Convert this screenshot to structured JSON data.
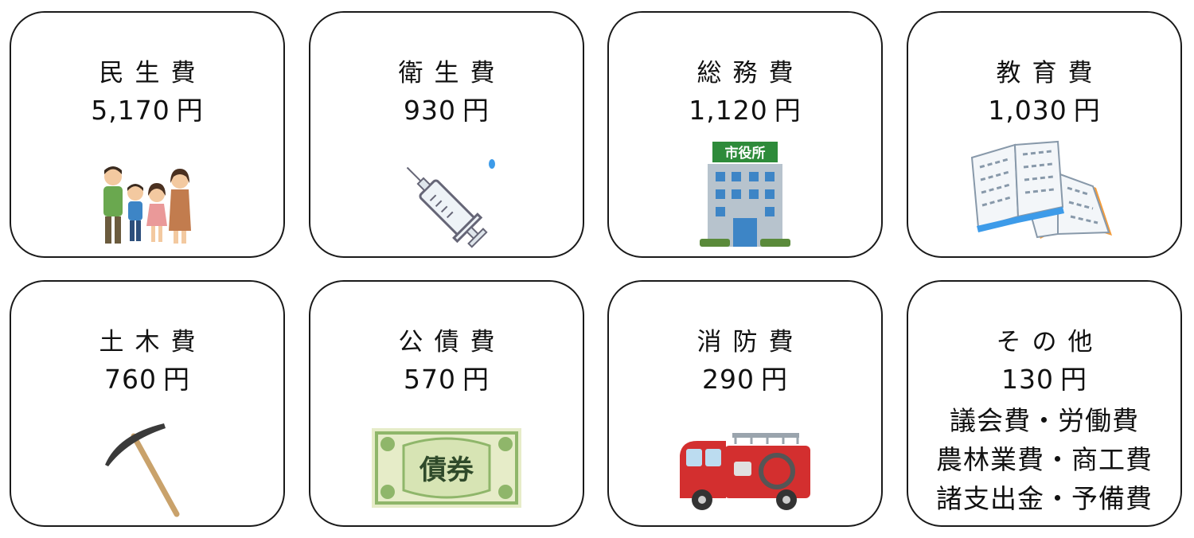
{
  "cards": [
    {
      "label": "民生費",
      "amount": "5,170",
      "unit": "円",
      "icon": "family-icon"
    },
    {
      "label": "衛生費",
      "amount": "930",
      "unit": "円",
      "icon": "syringe-icon"
    },
    {
      "label": "総務費",
      "amount": "1,120",
      "unit": "円",
      "icon": "city-hall-icon",
      "sign": "市役所"
    },
    {
      "label": "教育費",
      "amount": "1,030",
      "unit": "円",
      "icon": "open-books-icon"
    },
    {
      "label": "土木費",
      "amount": "760",
      "unit": "円",
      "icon": "pickaxe-icon"
    },
    {
      "label": "公債費",
      "amount": "570",
      "unit": "円",
      "icon": "bond-certificate-icon",
      "bond_text": "債券"
    },
    {
      "label": "消防費",
      "amount": "290",
      "unit": "円",
      "icon": "fire-truck-icon"
    },
    {
      "label": "その他",
      "amount": "130",
      "unit": "円",
      "details": [
        "議会費・労働費",
        "農林業費・商工費",
        "諸支出金・予備費"
      ]
    }
  ]
}
